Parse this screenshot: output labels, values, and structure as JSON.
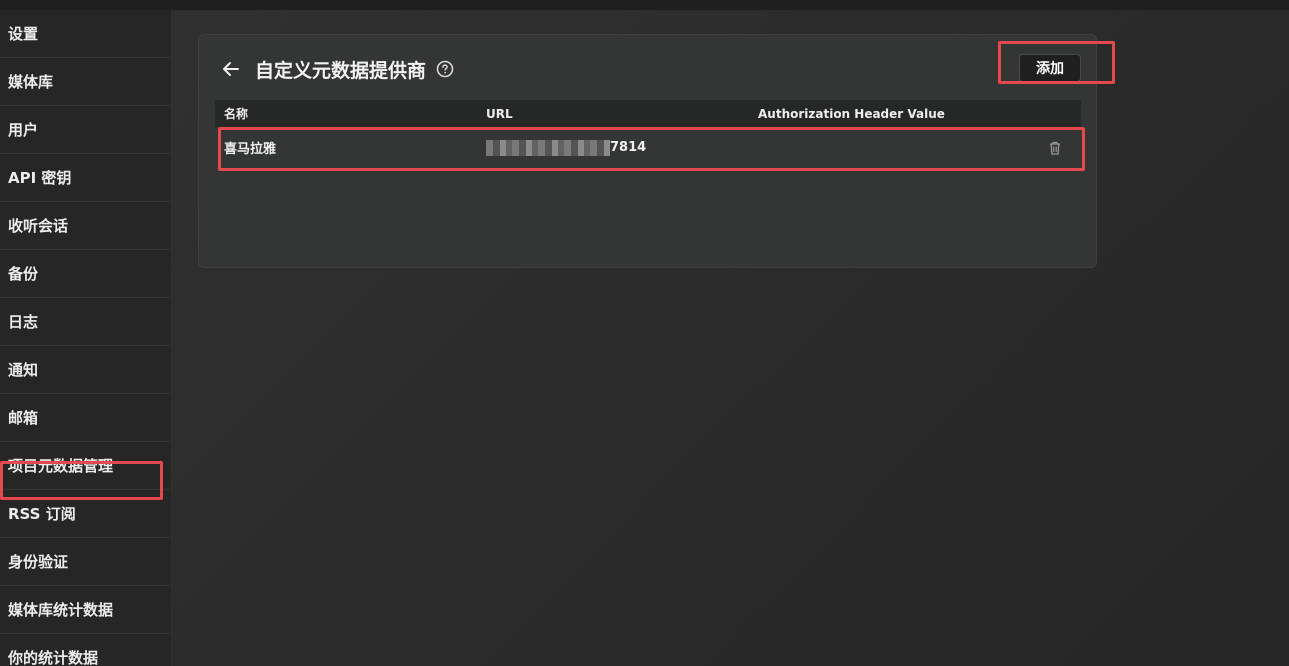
{
  "sidebar": {
    "items": [
      {
        "label": "设置"
      },
      {
        "label": "媒体库"
      },
      {
        "label": "用户"
      },
      {
        "label": "API 密钥"
      },
      {
        "label": "收听会话"
      },
      {
        "label": "备份"
      },
      {
        "label": "日志"
      },
      {
        "label": "通知"
      },
      {
        "label": "邮箱"
      },
      {
        "label": "项目元数据管理"
      },
      {
        "label": "RSS 订阅"
      },
      {
        "label": "身份验证"
      },
      {
        "label": "媒体库统计数据"
      },
      {
        "label": "你的统计数据"
      }
    ]
  },
  "page": {
    "title": "自定义元数据提供商",
    "back_icon": "arrow-left-icon",
    "help_icon": "question-circle-icon",
    "add_label": "添加"
  },
  "table": {
    "headers": {
      "name": "名称",
      "url": "URL",
      "auth": "Authorization Header Value"
    },
    "rows": [
      {
        "name": "喜马拉雅",
        "url_visible_suffix": "7814",
        "auth": "",
        "delete_icon": "trash-icon"
      }
    ]
  },
  "colors": {
    "highlight": "#e5484d",
    "background": "#2b2b2b",
    "card": "#343535"
  }
}
